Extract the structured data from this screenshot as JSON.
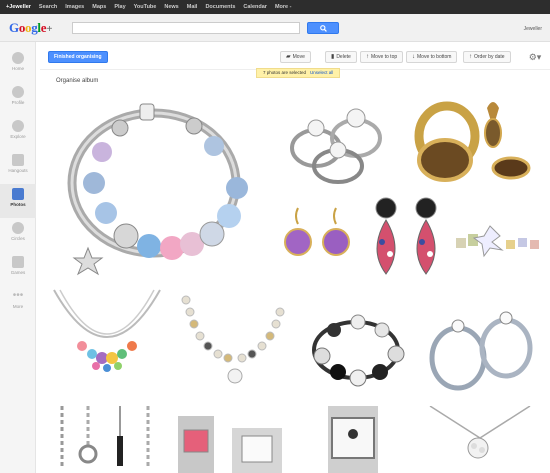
{
  "topbar": {
    "items": [
      "+Jeweller",
      "Search",
      "Images",
      "Maps",
      "Play",
      "YouTube",
      "News",
      "Mail",
      "Documents",
      "Calendar",
      "More -"
    ]
  },
  "header": {
    "logo": "Google+",
    "user_name": "Jeweller"
  },
  "rail": {
    "items": [
      {
        "label": "Home",
        "icon": "home-icon"
      },
      {
        "label": "Profile",
        "icon": "profile-icon"
      },
      {
        "label": "Explore",
        "icon": "explore-icon"
      },
      {
        "label": "Hangouts",
        "icon": "hangouts-icon"
      },
      {
        "label": "Photos",
        "icon": "photos-icon",
        "active": true
      },
      {
        "label": "Circles",
        "icon": "circles-icon"
      },
      {
        "label": "Games",
        "icon": "games-icon"
      },
      {
        "label": "More",
        "icon": "more-icon"
      }
    ]
  },
  "toolbar": {
    "finished": "Finished organising",
    "move": "Move",
    "delete": "Delete",
    "move_to_top": "Move to top",
    "move_to_bottom": "Move to bottom",
    "order_by_date": "Order by date"
  },
  "notice": {
    "text": "7 photos are selected",
    "undo": "Unselect all"
  },
  "album": {
    "title": "Organise album"
  },
  "colors": {
    "accent": "#4d90fe",
    "topbar": "#2d2d2d",
    "notice": "#fff1a8"
  }
}
